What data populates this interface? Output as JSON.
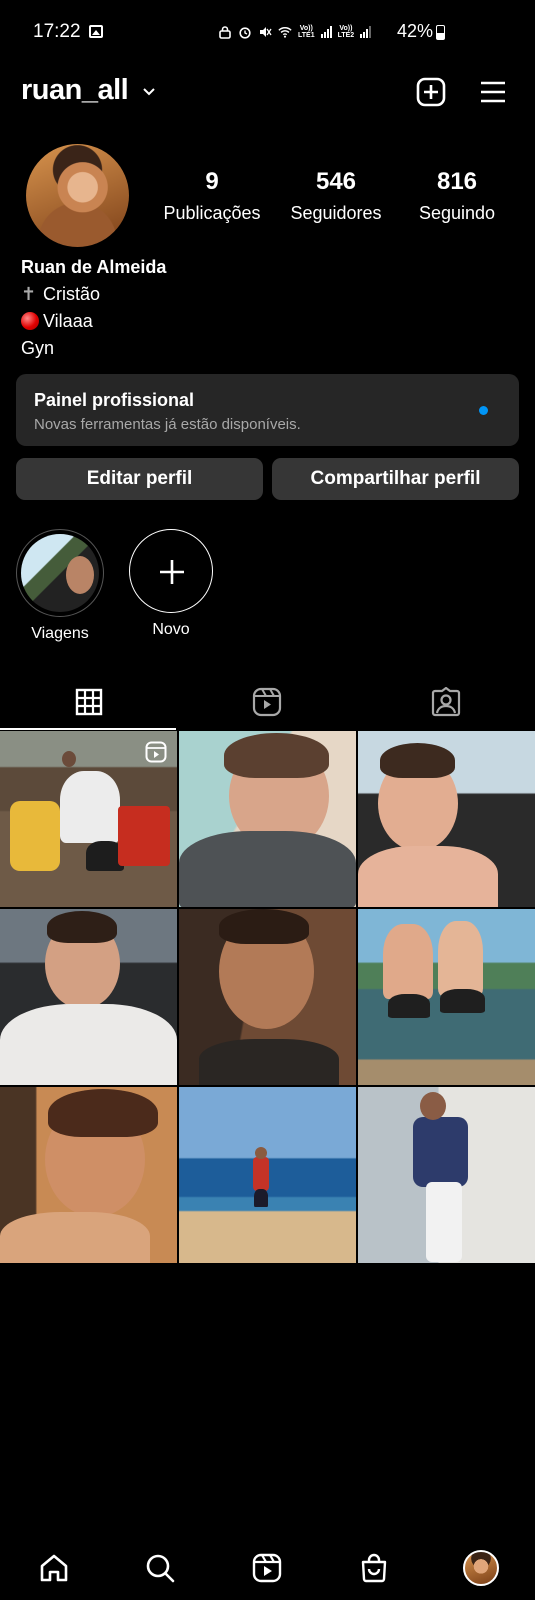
{
  "status_bar": {
    "time": "17:22",
    "battery": "42%",
    "sim1": "LTE1",
    "sim2": "LTE2",
    "volte": "Vo))"
  },
  "header": {
    "username": "ruan_all"
  },
  "profile": {
    "stats": [
      {
        "value": "9",
        "label": "Publicações"
      },
      {
        "value": "546",
        "label": "Seguidores"
      },
      {
        "value": "816",
        "label": "Seguindo"
      }
    ],
    "bio": {
      "name": "Ruan de Almeida",
      "line1": "Cristão",
      "line1_icon": "✝",
      "line2": "Vilaaa",
      "line3": "Gyn"
    }
  },
  "panel": {
    "title": "Painel profissional",
    "subtitle": "Novas ferramentas já estão disponíveis."
  },
  "buttons": {
    "edit": "Editar perfil",
    "share": "Compartilhar perfil"
  },
  "highlights": [
    {
      "label": "Viagens"
    },
    {
      "label": "Novo"
    }
  ],
  "tabs": [
    "grid-icon",
    "reels-icon",
    "tagged-icon"
  ],
  "nav": [
    "home-icon",
    "search-icon",
    "reels-icon",
    "shop-icon",
    "profile-avatar"
  ],
  "colors": {
    "background": "#000000",
    "panel": "#262626",
    "button": "#363636",
    "accent_dot": "#0095f6"
  }
}
